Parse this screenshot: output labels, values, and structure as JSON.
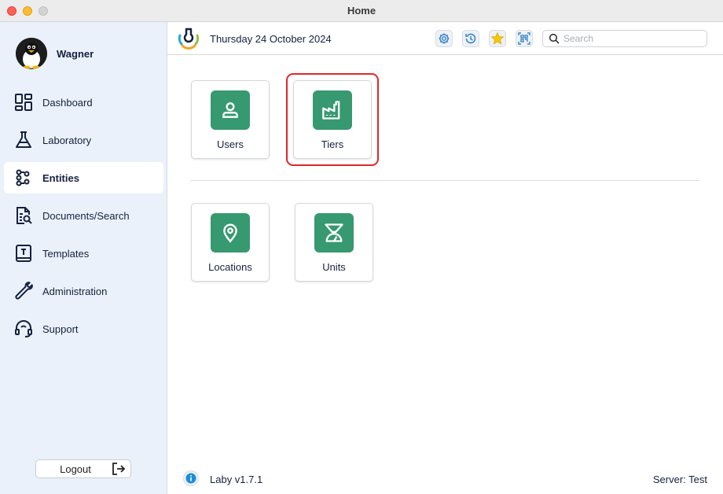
{
  "window": {
    "title": "Home"
  },
  "sidebar": {
    "user": {
      "name": "Wagner"
    },
    "items": [
      {
        "label": "Dashboard",
        "icon": "dashboard-icon",
        "active": false
      },
      {
        "label": "Laboratory",
        "icon": "flask-icon",
        "active": false
      },
      {
        "label": "Entities",
        "icon": "entities-icon",
        "active": true
      },
      {
        "label": "Documents/Search",
        "icon": "document-search-icon",
        "active": false
      },
      {
        "label": "Templates",
        "icon": "template-book-icon",
        "active": false
      },
      {
        "label": "Administration",
        "icon": "wrench-icon",
        "active": false
      },
      {
        "label": "Support",
        "icon": "headset-icon",
        "active": false
      }
    ],
    "logout_label": "Logout"
  },
  "toolbar": {
    "date": "Thursday 24 October 2024",
    "buttons": [
      "settings-icon",
      "history-icon",
      "star-icon",
      "qr-scan-icon"
    ],
    "search_placeholder": "Search"
  },
  "tiles": [
    {
      "label": "Users",
      "icon": "user-icon",
      "highlighted": false
    },
    {
      "label": "Tiers",
      "icon": "factory-icon",
      "highlighted": true
    },
    {
      "label": "Locations",
      "icon": "location-pin-icon",
      "highlighted": false
    },
    {
      "label": "Units",
      "icon": "scale-icon",
      "highlighted": false
    }
  ],
  "footer": {
    "version": "Laby v1.7.1",
    "server": "Server: Test"
  },
  "colors": {
    "accent_green": "#36996f",
    "highlight_red": "#e0262b",
    "sidebar_bg": "#eaf1fa",
    "text_navy": "#15213f"
  }
}
